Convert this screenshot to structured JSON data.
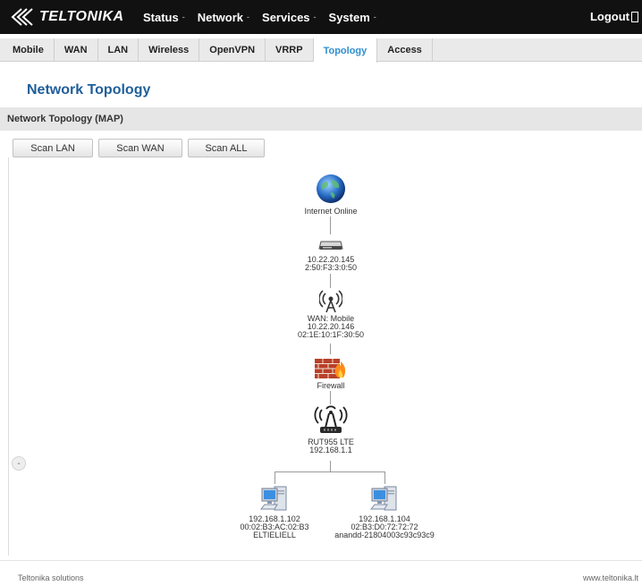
{
  "brand": {
    "name": "TELTONIKA"
  },
  "nav": {
    "items": [
      {
        "label": "Status",
        "caret": "-"
      },
      {
        "label": "Network",
        "caret": "-"
      },
      {
        "label": "Services",
        "caret": "-"
      },
      {
        "label": "System",
        "caret": "-"
      }
    ],
    "logout": "Logout"
  },
  "tabs": [
    {
      "label": "Mobile"
    },
    {
      "label": "WAN"
    },
    {
      "label": "LAN"
    },
    {
      "label": "Wireless"
    },
    {
      "label": "OpenVPN"
    },
    {
      "label": "VRRP"
    },
    {
      "label": "Topology",
      "active": true
    },
    {
      "label": "Access"
    }
  ],
  "page": {
    "title": "Network Topology",
    "section": "Network Topology (MAP)"
  },
  "buttons": {
    "scan_lan": "Scan LAN",
    "scan_wan": "Scan WAN",
    "scan_all": "Scan ALL"
  },
  "collapse": "-",
  "topology": {
    "internet": {
      "label": "Internet Online",
      "icon": "globe-icon"
    },
    "gateway": {
      "ip": "10.22.20.145",
      "mac": "2:50:F3:3:0:50",
      "icon": "gateway-device-icon"
    },
    "wan": {
      "name": "WAN: Mobile",
      "ip": "10.22.20.146",
      "mac": "02:1E:10:1F:30:50",
      "icon": "antenna-icon"
    },
    "firewall": {
      "label": "Firewall",
      "icon": "firewall-icon"
    },
    "router": {
      "name": "RUT955 LTE",
      "ip": "192.168.1.1",
      "icon": "router-icon"
    },
    "clients": [
      {
        "ip": "192.168.1.102",
        "mac": "00:02:B3:AC:02:B3",
        "hostname": "ELTIELIELL",
        "icon": "computer-icon"
      },
      {
        "ip": "192.168.1.104",
        "mac": "02:B3:D0:72:72:72",
        "hostname": "anandd-21804003c93c93c9",
        "icon": "computer-icon"
      }
    ]
  },
  "footer": {
    "left": "Teltonika solutions",
    "right": "www.teltonika.lt"
  },
  "colors": {
    "accent": "#2f8fcf",
    "title": "#1f5e9a",
    "topbar": "#111111"
  }
}
